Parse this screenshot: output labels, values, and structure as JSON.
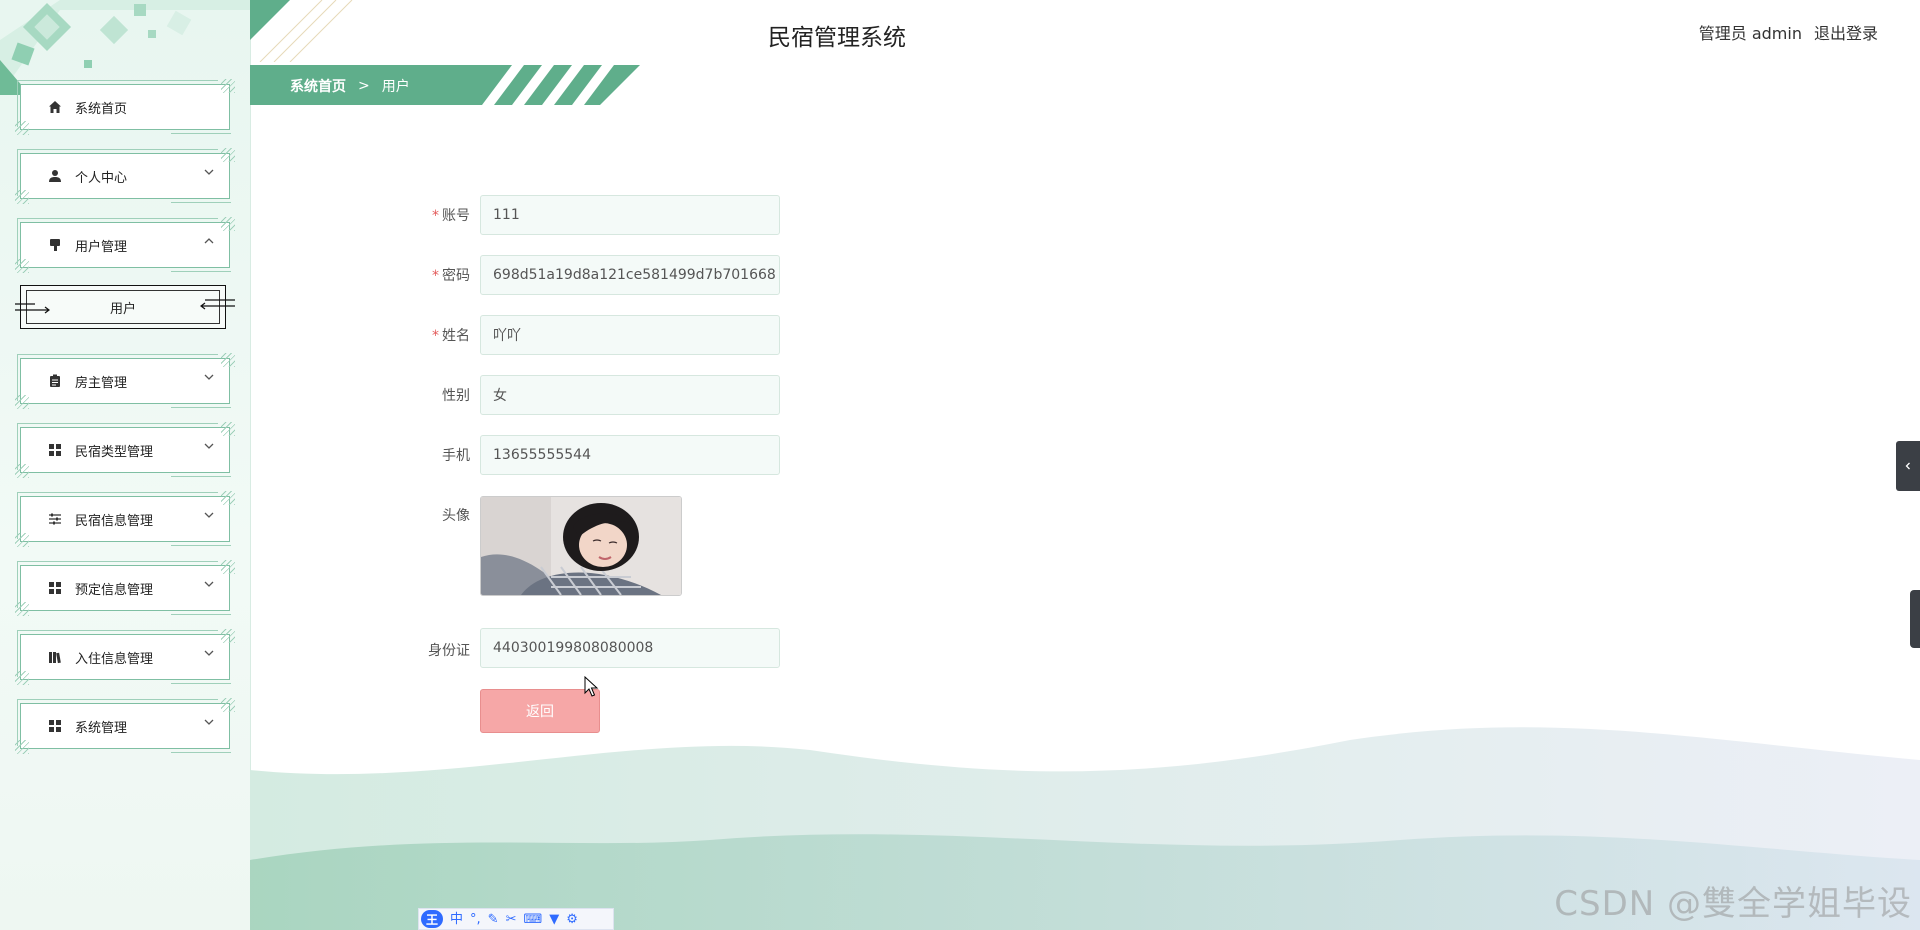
{
  "header": {
    "title": "民宿管理系统",
    "role": "管理员",
    "username": "admin",
    "logout_label": "退出登录"
  },
  "breadcrumb": {
    "home": "系统首页",
    "separator": ">",
    "current": "用户"
  },
  "sidebar": {
    "items": [
      {
        "label": "系统首页",
        "icon": "home-icon",
        "expandable": false
      },
      {
        "label": "个人中心",
        "icon": "person-icon",
        "expandable": true,
        "expanded": false
      },
      {
        "label": "用户管理",
        "icon": "users-icon",
        "expandable": true,
        "expanded": true
      },
      {
        "label": "房主管理",
        "icon": "clipboard-icon",
        "expandable": true,
        "expanded": false
      },
      {
        "label": "民宿类型管理",
        "icon": "grid-icon",
        "expandable": true,
        "expanded": false
      },
      {
        "label": "民宿信息管理",
        "icon": "sliders-icon",
        "expandable": true,
        "expanded": false
      },
      {
        "label": "预定信息管理",
        "icon": "grid-icon",
        "expandable": true,
        "expanded": false
      },
      {
        "label": "入住信息管理",
        "icon": "book-icon",
        "expandable": true,
        "expanded": false
      },
      {
        "label": "系统管理",
        "icon": "grid-icon",
        "expandable": true,
        "expanded": false
      }
    ],
    "submenu": {
      "label": "用户"
    }
  },
  "form": {
    "account": {
      "label": "账号",
      "value": "111",
      "required": true
    },
    "password": {
      "label": "密码",
      "value": "698d51a19d8a121ce581499d7b701668",
      "required": true
    },
    "name": {
      "label": "姓名",
      "value": "吖吖",
      "required": true
    },
    "gender": {
      "label": "性别",
      "value": "女",
      "required": false
    },
    "phone": {
      "label": "手机",
      "value": "13655555544",
      "required": false
    },
    "avatar": {
      "label": "头像"
    },
    "id_card": {
      "label": "身份证",
      "value": "440300199808080008",
      "required": false
    },
    "back_label": "返回"
  },
  "ime": {
    "logo": "王",
    "mode": "中"
  },
  "watermark": "CSDN @雙全学姐毕设",
  "colors": {
    "primary": "#5fae8b",
    "back_button": "#f6a7a7",
    "required": "#e35a5a"
  }
}
